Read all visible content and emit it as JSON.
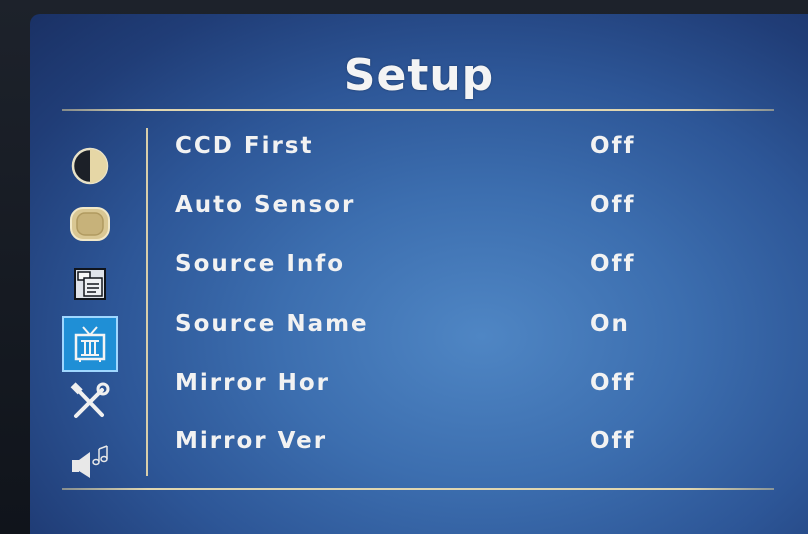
{
  "title": "Setup",
  "side_icons": [
    {
      "name": "contrast-icon",
      "selected": false
    },
    {
      "name": "display-frame-icon",
      "selected": false
    },
    {
      "name": "info-window-icon",
      "selected": false
    },
    {
      "name": "tv-icon",
      "selected": true
    },
    {
      "name": "tools-icon",
      "selected": false
    },
    {
      "name": "speaker-music-icon",
      "selected": false
    }
  ],
  "menu": {
    "items": [
      {
        "label": "CCD First",
        "value": "Off"
      },
      {
        "label": "Auto Sensor",
        "value": "Off"
      },
      {
        "label": "Source Info",
        "value": "Off"
      },
      {
        "label": "Source Name",
        "value": "On"
      },
      {
        "label": "Mirror Hor",
        "value": "Off"
      },
      {
        "label": "Mirror Ver",
        "value": "Off"
      }
    ]
  },
  "colors": {
    "accent": "#1f8fd6",
    "text": "#f2f2f2",
    "rule": "#e0d6b0",
    "background": "#3c6eaf"
  }
}
